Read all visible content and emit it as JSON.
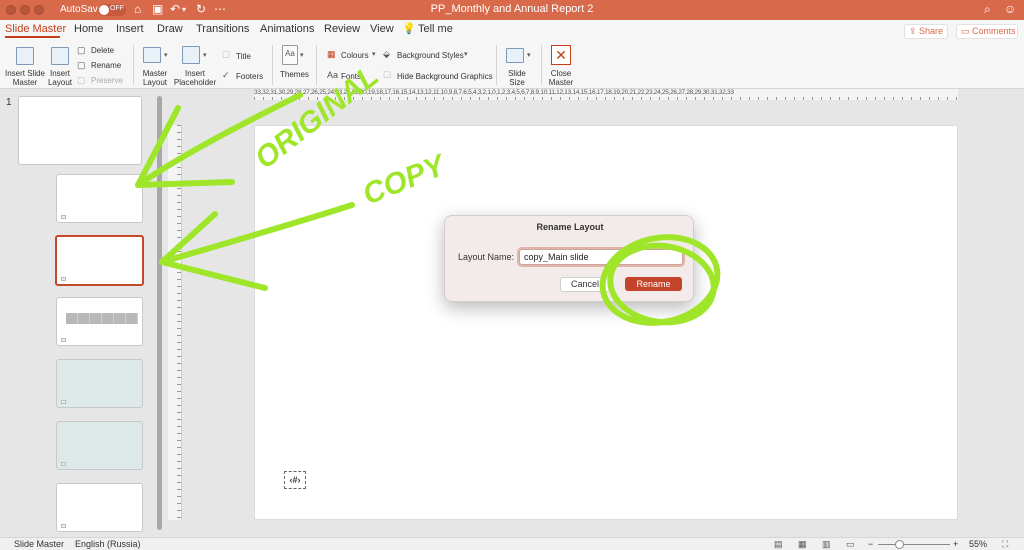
{
  "titlebar": {
    "autosave_label": "AutoSave",
    "autosave_state": "OFF",
    "document_title": "PP_Monthly and Annual Report 2",
    "color": "#d9694b"
  },
  "tabs": {
    "items": [
      {
        "label": "Slide Master",
        "active": true
      },
      {
        "label": "Home"
      },
      {
        "label": "Insert"
      },
      {
        "label": "Draw"
      },
      {
        "label": "Transitions"
      },
      {
        "label": "Animations"
      },
      {
        "label": "Review"
      },
      {
        "label": "View"
      }
    ],
    "tell_me": "Tell me",
    "share": "Share",
    "comments": "Comments",
    "accent": "#c43e1c"
  },
  "ribbon": {
    "insert_slide_master": "Insert Slide Master",
    "insert_slide_master_l1": "Insert Slide",
    "insert_slide_master_l2": "Master",
    "insert_layout_l1": "Insert",
    "insert_layout_l2": "Layout",
    "delete": "Delete",
    "rename": "Rename",
    "preserve": "Preserve",
    "master_layout_l1": "Master",
    "master_layout_l2": "Layout",
    "insert_placeholder_l1": "Insert",
    "insert_placeholder_l2": "Placeholder",
    "title": "Title",
    "footers": "Footers",
    "themes": "Themes",
    "colours": "Colours",
    "fonts": "Fonts",
    "background_styles": "Background Styles",
    "hide_background_graphics": "Hide Background Graphics",
    "slide_size_l1": "Slide",
    "slide_size_l2": "Size",
    "close_master_l1": "Close",
    "close_master_l2": "Master"
  },
  "thumbnails": {
    "slide_number": "1",
    "selected_index": 2,
    "selected_border": "#c4482a"
  },
  "ruler": {
    "horizontal_text": "33,32,31,30,29,28,27,26,25,24,23,22,21,20,19,18,17,16,15,14,13,12,11,10,9,8,7,6,5,4,3,2,1,0,1,2,3,4,5,6,7,8,9,10,11,12,13,14,15,16,17,18,19,20,21,22,23,24,25,26,27,28,29,30,31,32,33"
  },
  "slide": {
    "number_placeholder": "‹#›"
  },
  "dialog": {
    "title": "Rename Layout",
    "field_label": "Layout Name:",
    "field_value": "copy_Main slide",
    "cancel": "Cancel",
    "rename": "Rename",
    "primary_color": "#c2442a"
  },
  "statusbar": {
    "mode": "Slide Master",
    "language": "English (Russia)",
    "zoom": "55%",
    "zoom_minus": "−",
    "zoom_plus": "+"
  },
  "annotations": {
    "original": "ORIGINAL",
    "copy": "COPY",
    "color": "#9fe62a"
  }
}
